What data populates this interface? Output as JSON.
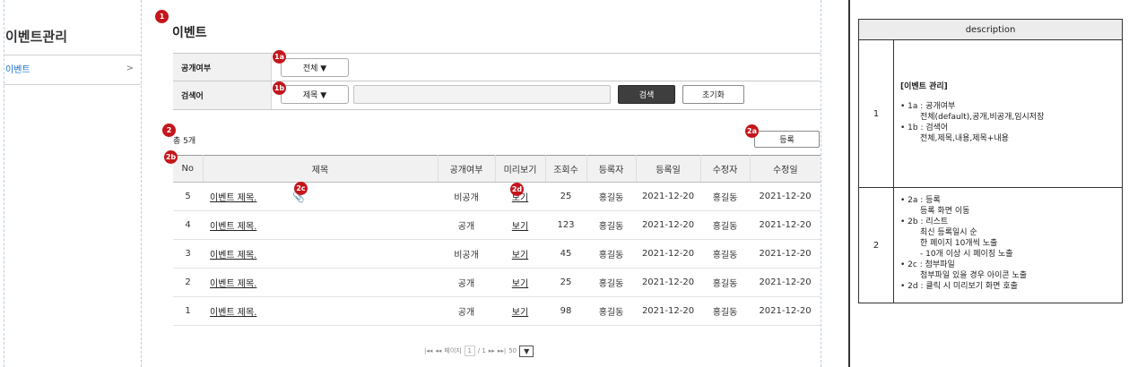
{
  "sidebar": {
    "title": "이벤트관리",
    "items": [
      {
        "label": "이벤트",
        "chevron": ">"
      }
    ]
  },
  "main": {
    "page_title": "이벤트",
    "search": {
      "visibility_label": "공개여부",
      "visibility_value": "전체 ▼",
      "keyword_label": "검색어",
      "keyword_type": "제목 ▼",
      "keyword_value": "",
      "search_button": "검색",
      "reset_button": "초기화"
    },
    "total_text": "총 5개",
    "register_button": "등록",
    "table": {
      "columns": [
        "No",
        "제목",
        "공개여부",
        "미리보기",
        "조회수",
        "등록자",
        "등록일",
        "수정자",
        "수정일"
      ],
      "rows": [
        {
          "no": "5",
          "title": "이벤트 제목.",
          "visibility": "비공개",
          "preview": "보기",
          "views": "25",
          "author": "홍길동",
          "created": "2021-12-20",
          "editor": "홍길동",
          "modified": "2021-12-20",
          "attachment": true
        },
        {
          "no": "4",
          "title": "이벤트 제목.",
          "visibility": "공개",
          "preview": "보기",
          "views": "123",
          "author": "홍길동",
          "created": "2021-12-20",
          "editor": "홍길동",
          "modified": "2021-12-20",
          "attachment": false
        },
        {
          "no": "3",
          "title": "이벤트 제목.",
          "visibility": "비공개",
          "preview": "보기",
          "views": "45",
          "author": "홍길동",
          "created": "2021-12-20",
          "editor": "홍길동",
          "modified": "2021-12-20",
          "attachment": false
        },
        {
          "no": "2",
          "title": "이벤트 제목.",
          "visibility": "공개",
          "preview": "보기",
          "views": "25",
          "author": "홍길동",
          "created": "2021-12-20",
          "editor": "홍길동",
          "modified": "2021-12-20",
          "attachment": false
        },
        {
          "no": "1",
          "title": "이벤트 제목.",
          "visibility": "공개",
          "preview": "보기",
          "views": "98",
          "author": "홍길동",
          "created": "2021-12-20",
          "editor": "홍길동",
          "modified": "2021-12-20",
          "attachment": false
        }
      ]
    },
    "pagination": {
      "first": "|◂◂",
      "prev": "◂◂",
      "page_label": "페이지",
      "current_page": "1",
      "total_pages": "/ 1",
      "next": "▸▸",
      "last": "▸▸|",
      "page_size": "50",
      "dropdown": "▼"
    }
  },
  "badges": {
    "b1": "1",
    "b1a": "1a",
    "b1b": "1b",
    "b2": "2",
    "b2a": "2a",
    "b2b": "2b",
    "b2c": "2c",
    "b2d": "2d"
  },
  "description": {
    "header": "description",
    "rows": [
      {
        "num": "1",
        "title": "[이벤트 관리]",
        "lines": [
          "• 1a : 공개여부",
          "전체(default),공개,비공개,임시저장",
          "• 1b : 검색어",
          "전체,제목,내용,제목+내용"
        ]
      },
      {
        "num": "2",
        "lines": [
          "• 2a : 등록",
          "등록 화면 이동",
          "• 2b : 리스트",
          "최신 등록일시 순",
          "한 페이지 10개씩 노출",
          "- 10개 이상 시 페이징 노출",
          "• 2c : 첨부파일",
          "첨부파일 있을 경우 아이콘 노출",
          "• 2d : 클릭 시 미리보기 화면 호출"
        ]
      }
    ]
  }
}
